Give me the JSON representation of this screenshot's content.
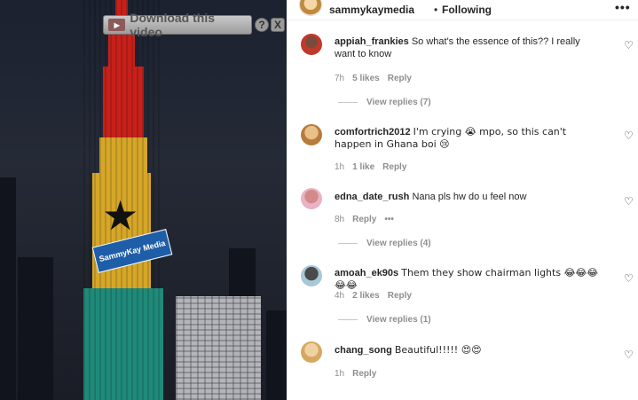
{
  "video": {
    "download_label": "Download this video",
    "help_label": "?",
    "close_label": "X",
    "watermark_text": "SammyKay Media"
  },
  "header": {
    "username": "sammykaymedia",
    "separator": "•",
    "follow_status": "Following",
    "more_label": "•••"
  },
  "comments": [
    {
      "username": "appiah_frankies",
      "text": "So what's the essence of this?? I really want to know",
      "time": "7h",
      "likes": "5 likes",
      "reply_label": "Reply",
      "view_replies": "View replies (7)"
    },
    {
      "username": "comfortrich2012",
      "text": "I'm crying 😭 mpo, so this can't happen in Ghana boi 😢",
      "time": "1h",
      "likes": "1 like",
      "reply_label": "Reply"
    },
    {
      "username": "edna_date_rush",
      "text": "Nana pls hw do u feel now",
      "time": "8h",
      "reply_label": "Reply",
      "options_label": "•••",
      "view_replies": "View replies (4)"
    },
    {
      "username": "amoah_ek90s",
      "text": "Them they show chairman lights 😂😂😂😂😂",
      "time": "4h",
      "likes": "2 likes",
      "reply_label": "Reply",
      "view_replies": "View replies (1)"
    },
    {
      "username": "chang_song",
      "text": "Beautiful!!!!! 😍😍",
      "time": "1h",
      "reply_label": "Reply"
    }
  ],
  "colors": {
    "flag_red": "#c8201a",
    "flag_yellow": "#d6a628",
    "flag_green": "#1f8a7a",
    "text_primary": "#262626",
    "text_secondary": "#8e8e8e"
  }
}
